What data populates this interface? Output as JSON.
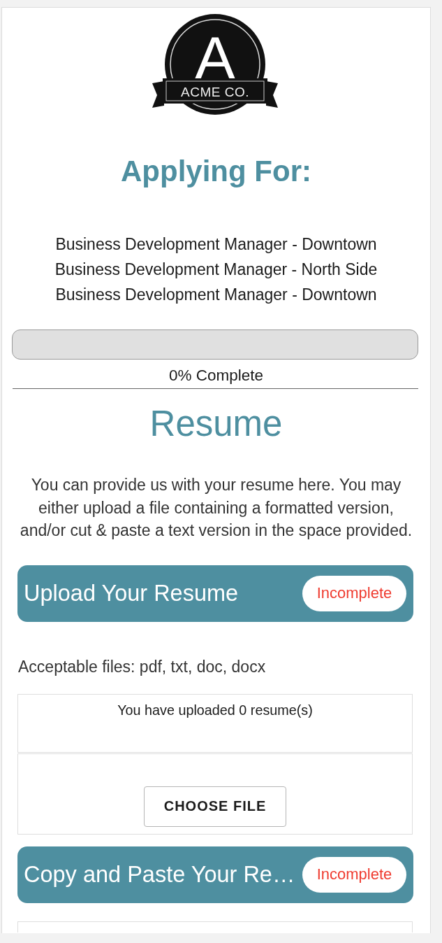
{
  "logo": {
    "letter": "A",
    "wordmark": "ACME CO."
  },
  "applying": {
    "heading": "Applying For:",
    "positions": [
      "Business Development Manager - Downtown",
      "Business Development Manager - North Side",
      "Business Development Manager - Downtown"
    ]
  },
  "progress": {
    "level": 0,
    "label": "0% Complete"
  },
  "section": {
    "heading": "Resume",
    "intro": "You can provide us with your resume here. You may either upload a file containing a formatted version, and/or cut & paste a text version in the space provided."
  },
  "steps": [
    {
      "kind": "upload",
      "title": "Upload Your Resume",
      "status": "Incomplete",
      "complete": false,
      "note": "Acceptable files: pdf, txt, doc, docx",
      "uploaded_text": "You have uploaded 0 resume(s)",
      "button": "CHOOSE FILE"
    },
    {
      "kind": "paste",
      "title": "Copy and Paste Your Re…",
      "status": "Incomplete",
      "complete": false
    }
  ]
}
